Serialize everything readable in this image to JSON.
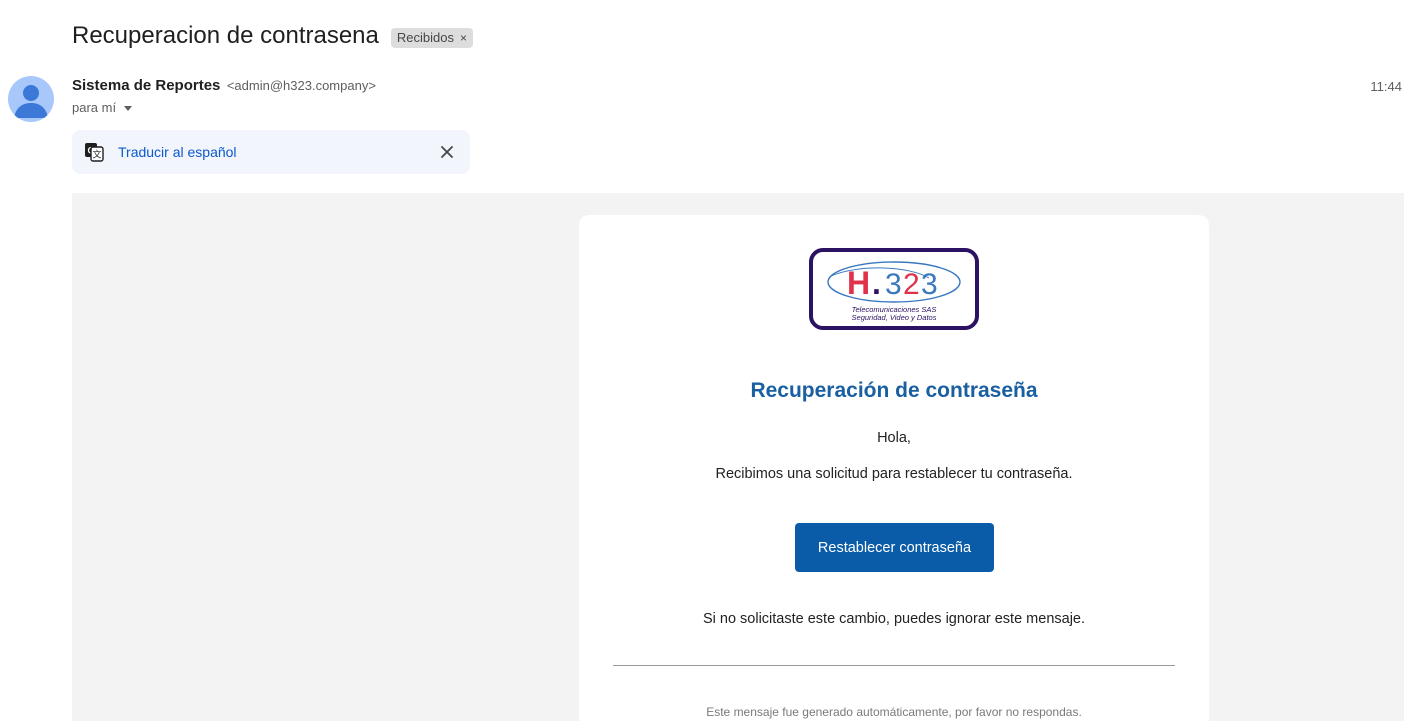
{
  "email": {
    "subject": "Recuperacion de contrasena",
    "label": "Recibidos",
    "label_remove": "×",
    "sender_name": "Sistema de Reportes",
    "sender_email": "<admin@h323.company>",
    "to_line": "para mí",
    "time": "11:44"
  },
  "translate": {
    "link": "Traducir al español"
  },
  "body": {
    "logo_text": "H.323",
    "logo_sub1": "Telecomunicaciones SAS",
    "logo_sub2": "Seguridad, Video y Datos",
    "title": "Recuperación de contraseña",
    "greeting": "Hola,",
    "request_text": "Recibimos una solicitud para restablecer tu contraseña.",
    "button_label": "Restablecer contraseña",
    "ignore_text": "Si no solicitaste este cambio, puedes ignorar este mensaje.",
    "footer_text": "Este mensaje fue generado automáticamente, por favor no respondas."
  },
  "colors": {
    "title_blue": "#1a5fa0",
    "button_blue": "#0a5ca8",
    "link_blue": "#0b57d0",
    "logo_border": "#2b1263",
    "logo_red": "#e0324b",
    "logo_blue": "#3a78c0"
  },
  "icons": {
    "avatar": "person-avatar-icon",
    "translate": "translate-icon",
    "close": "close-icon",
    "caret": "caret-down-icon"
  }
}
